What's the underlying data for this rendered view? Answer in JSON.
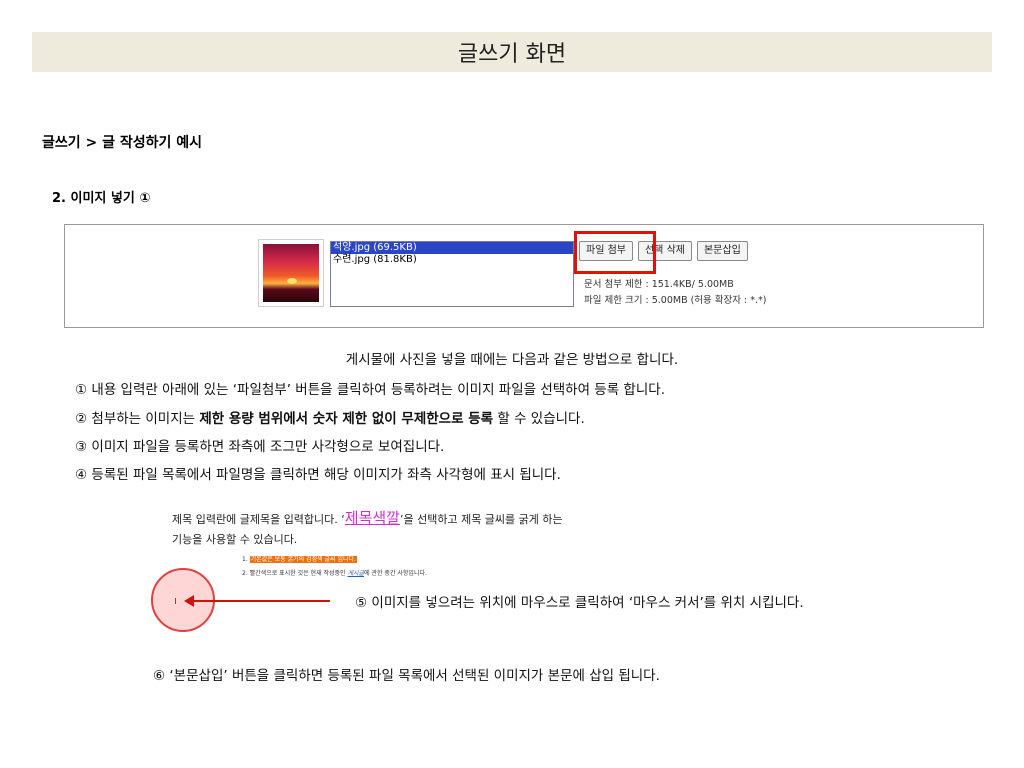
{
  "title": "글쓰기 화면",
  "breadcrumb": "글쓰기 > 글 작성하기 예시",
  "section": "2. 이미지 넣기 ①",
  "uploader": {
    "files": [
      "석양.jpg (69.5KB)",
      "수련.jpg (81.8KB)"
    ],
    "selected_index": 0,
    "buttons": {
      "attach": "파일 첨부",
      "delete": "선택 삭제",
      "insert": "본문삽입"
    },
    "limit_doc": "문서 첨부 제한 : 151.4KB/ 5.00MB",
    "limit_file": "파일 제한 크기 : 5.00MB (허용 확장자 : *.*)"
  },
  "instructions": {
    "intro": "게시물에 사진을 넣을 때에는 다음과 같은 방법으로 합니다.",
    "step1": "① 내용 입력란 아래에 있는 ‘파일첨부’ 버튼을 클릭하여 등록하려는 이미지 파일을 선택하여 등록 합니다.",
    "step2_pre": "② 첨부하는 이미지는 ",
    "step2_bold": "제한 용량 범위에서 숫자 제한 없이 무제한으로 등록",
    "step2_post": " 할 수 있습니다.",
    "step3": "③ 이미지 파일을 등록하면 좌측에 조그만 사각형으로 보여집니다.",
    "step4": "④ 등록된 파일 목록에서 파일명을 클릭하면 해당 이미지가 좌측 사각형에 표시 됩니다.",
    "step5": "⑤ 이미지를 넣으려는 위치에 마우스로 클릭하여 ‘마우스 커서’를 위치 시킵니다.",
    "step6": "⑥ ‘본문삽입’ 버튼을 클릭하면 등록된 파일 목록에서 선택된 이미지가 본문에 삽입 됩니다."
  },
  "editor_sample": {
    "line1_pre": "제목 입력란에 글제목을 입력합니다. ‘",
    "line1_color": "제목색깔",
    "line1_post": "’을 선택하고 제목 글씨를 굵게 하는",
    "line2": "기능을 사용할 수 있습니다.",
    "tiny1_num": "1.",
    "tiny1_hl": "기본값은 보통 굵기의 검정색 글씨 입니다.",
    "tiny2_pre": "2. 빨간색으로 표시한 것은 현재 작성중인 ",
    "tiny2_blue": "게시글",
    "tiny2_post": "에 관한 중간 사항입니다."
  },
  "colors": {
    "title_bg": "#eeeadc",
    "highlight": "#e01010",
    "selected_item": "#2a46c4",
    "color_word": "#d030d0"
  }
}
